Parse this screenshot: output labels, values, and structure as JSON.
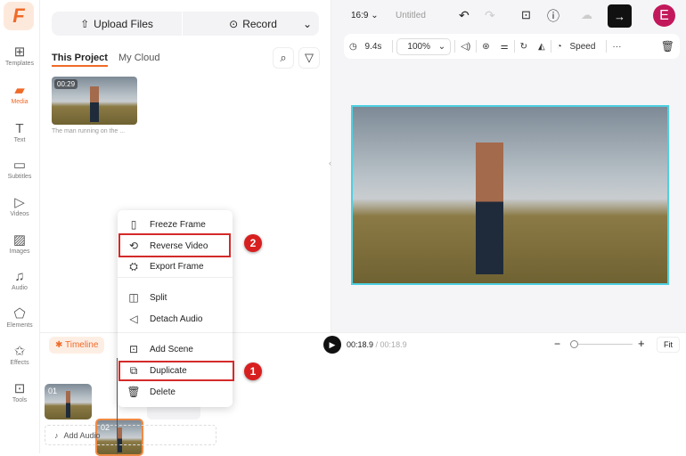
{
  "rail": {
    "logo": "F",
    "items": [
      {
        "label": "Templates",
        "icon": "templates-icon",
        "glyph": "⊞"
      },
      {
        "label": "Media",
        "icon": "media-folder-icon",
        "glyph": "▰"
      },
      {
        "label": "Text",
        "icon": "text-icon",
        "glyph": "T"
      },
      {
        "label": "Subtitles",
        "icon": "subtitles-icon",
        "glyph": "▭"
      },
      {
        "label": "Videos",
        "icon": "videos-icon",
        "glyph": "▷"
      },
      {
        "label": "Images",
        "icon": "images-icon",
        "glyph": "▨"
      },
      {
        "label": "Audio",
        "icon": "audio-icon",
        "glyph": "♫"
      },
      {
        "label": "Elements",
        "icon": "elements-icon",
        "glyph": "⬠"
      },
      {
        "label": "Effects",
        "icon": "effects-icon",
        "glyph": "✩"
      },
      {
        "label": "Tools",
        "icon": "tools-icon",
        "glyph": "⊡"
      }
    ]
  },
  "media": {
    "upload_label": "Upload Files",
    "record_label": "Record",
    "tabs": [
      "This Project",
      "My Cloud"
    ],
    "clip": {
      "duration": "00:29",
      "name": "The man running on the ..."
    }
  },
  "header": {
    "aspect": "16:9",
    "title": "Untitled",
    "avatar": "E"
  },
  "toolbar": {
    "duration": "9.4s",
    "zoom": "100%",
    "speed": "Speed"
  },
  "menu": {
    "items": [
      "Freeze Frame",
      "Reverse Video",
      "Export Frame",
      "Split",
      "Detach Audio",
      "Add Scene",
      "Duplicate",
      "Delete"
    ]
  },
  "badges": [
    "1",
    "2"
  ],
  "timeline": {
    "tab": "Timeline",
    "current": "00:18.9",
    "total": "/ 00:18.9",
    "fit": "Fit",
    "scenes": [
      "01",
      "02"
    ],
    "add_audio": "Add Audio",
    "zoom_level": 0.1
  },
  "colors": {
    "accent": "#f06a28",
    "highlight": "#d42a2a",
    "selection": "#4dd0e1"
  }
}
